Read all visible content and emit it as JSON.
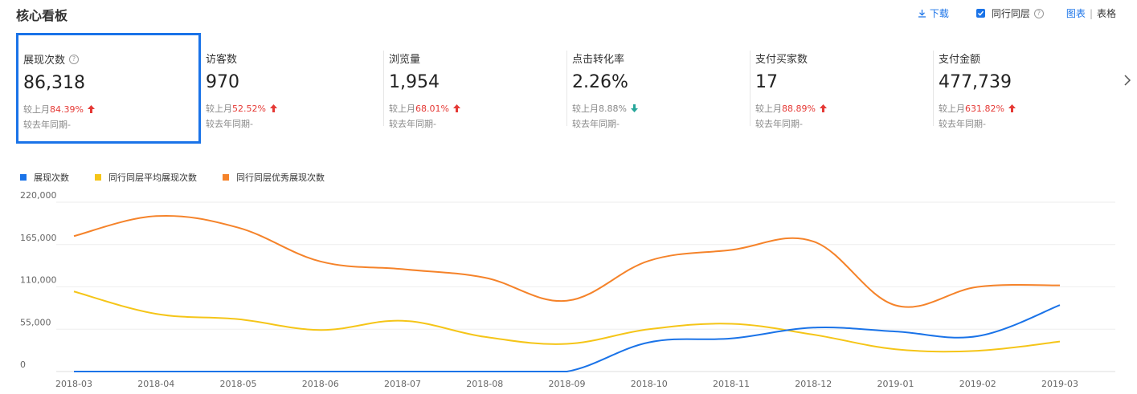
{
  "header": {
    "title": "核心看板",
    "download_label": "下载",
    "peer_checkbox_label": "同行同层",
    "peer_checkbox_checked": true,
    "view_chart_label": "图表",
    "view_separator": "|",
    "view_table_label": "表格"
  },
  "metrics": [
    {
      "label": "展现次数",
      "help": "?",
      "value": "86,318",
      "mom_label": "较上月",
      "mom_value": "84.39%",
      "trend": "up",
      "yoy_text": "较去年同期-",
      "active": true
    },
    {
      "label": "访客数",
      "value": "970",
      "mom_label": "较上月",
      "mom_value": "52.52%",
      "trend": "up",
      "yoy_text": "较去年同期-"
    },
    {
      "label": "浏览量",
      "value": "1,954",
      "mom_label": "较上月",
      "mom_value": "68.01%",
      "trend": "up",
      "yoy_text": "较去年同期-"
    },
    {
      "label": "点击转化率",
      "value": "2.26%",
      "mom_label": "较上月",
      "mom_value": "8.88%",
      "trend": "down",
      "yoy_text": "较去年同期-"
    },
    {
      "label": "支付买家数",
      "value": "17",
      "mom_label": "较上月",
      "mom_value": "88.89%",
      "trend": "up",
      "yoy_text": "较去年同期-"
    },
    {
      "label": "支付金额",
      "value": "477,739",
      "mom_label": "较上月",
      "mom_value": "631.82%",
      "trend": "up",
      "yoy_text": "较去年同期-"
    }
  ],
  "colors": {
    "accent": "#1a73e8",
    "up": "#e53935",
    "down": "#26a69a"
  },
  "chart_data": {
    "type": "line",
    "x": [
      "2018-03",
      "2018-04",
      "2018-05",
      "2018-06",
      "2018-07",
      "2018-08",
      "2018-09",
      "2018-10",
      "2018-11",
      "2018-12",
      "2019-01",
      "2019-02",
      "2019-03"
    ],
    "ylim": [
      0,
      220000
    ],
    "yticks": [
      "0",
      "55,000",
      "110,000",
      "165,000",
      "220,000"
    ],
    "grid": true,
    "legend_position": "top-left",
    "series": [
      {
        "name": "展现次数",
        "color": "#1a73e8",
        "values": [
          0,
          0,
          0,
          0,
          0,
          0,
          0,
          38000,
          43000,
          57000,
          52000,
          46000,
          86318
        ]
      },
      {
        "name": "同行同层平均展现次数",
        "color": "#f5c518",
        "values": [
          104000,
          75000,
          68000,
          54000,
          66000,
          45000,
          36000,
          55000,
          62000,
          48000,
          29000,
          27000,
          39000
        ]
      },
      {
        "name": "同行同层优秀展现次数",
        "color": "#f5832a",
        "values": [
          176000,
          202000,
          187000,
          143000,
          133000,
          122000,
          92000,
          144000,
          158000,
          169000,
          86000,
          110000,
          112000
        ]
      }
    ]
  }
}
